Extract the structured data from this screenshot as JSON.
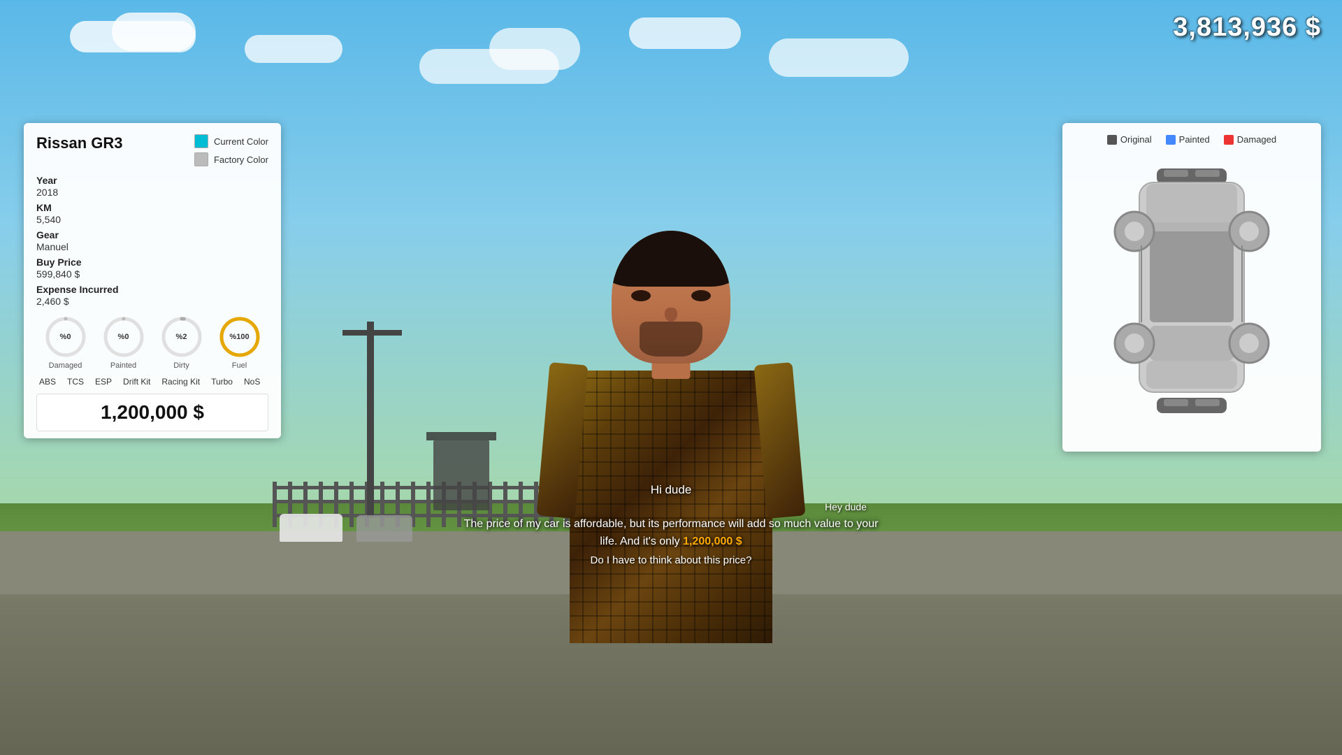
{
  "hud": {
    "money": "3,813,936 $"
  },
  "car_info": {
    "name": "Rissan GR3",
    "current_color_label": "Current Color",
    "factory_color_label": "Factory Color",
    "year_label": "Year",
    "year_value": "2018",
    "km_label": "KM",
    "km_value": "5,540",
    "gear_label": "Gear",
    "gear_value": "Manuel",
    "buy_price_label": "Buy Price",
    "buy_price_value": "599,840 $",
    "expense_label": "Expense Incurred",
    "expense_value": "2,460 $",
    "gauges": [
      {
        "id": "damaged",
        "label": "Damaged",
        "value": "%0",
        "percent": 0,
        "color": "#aaa"
      },
      {
        "id": "painted",
        "label": "Painted",
        "value": "%0",
        "percent": 0,
        "color": "#aaa"
      },
      {
        "id": "dirty",
        "label": "Dirty",
        "value": "%2",
        "percent": 2,
        "color": "#aaa"
      },
      {
        "id": "fuel",
        "label": "Fuel",
        "value": "%100",
        "percent": 100,
        "color": "#e6a800"
      }
    ],
    "mods": [
      "ABS",
      "TCS",
      "ESP",
      "Drift Kit",
      "Racing Kit",
      "Turbo",
      "NoS"
    ],
    "sell_price": "1,200,000 $"
  },
  "diagram": {
    "legend": [
      {
        "id": "original",
        "label": "Original",
        "color": "dark"
      },
      {
        "id": "painted",
        "label": "Painted",
        "color": "blue"
      },
      {
        "id": "damaged",
        "label": "Damaged",
        "color": "red"
      }
    ]
  },
  "chat": {
    "greeting": "Hi dude",
    "speaker": "Hey dude",
    "main_text": "The price of my car is affordable, but its performance will add so much value to your life. And it's only",
    "price_highlight": "1,200,000 $",
    "question": "Do I have to think about this price?"
  }
}
